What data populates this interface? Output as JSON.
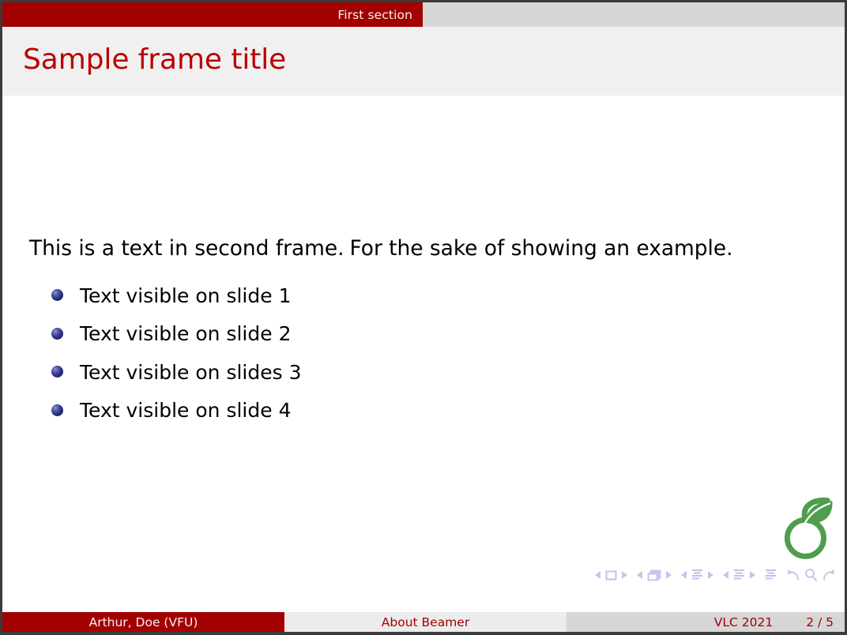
{
  "slide": {
    "section_bar": {
      "active_section": "First section"
    },
    "frame_title": "Sample frame title",
    "paragraph_part1": "This is a text in second frame.",
    "paragraph_part2": "For the sake of showing an example.",
    "bullets": [
      {
        "label": "Text visible on slide 1",
        "bullet_icon": "ball-bullet-icon"
      },
      {
        "label": "Text visible on slide 2",
        "bullet_icon": "ball-bullet-icon"
      },
      {
        "label": "Text visible on slides 3",
        "bullet_icon": "ball-bullet-icon"
      },
      {
        "label": "Text visible on slide 4",
        "bullet_icon": "ball-bullet-icon"
      }
    ],
    "logo": {
      "icon": "green-sprout-six-logo-icon"
    },
    "navigation_symbols": [
      "slide-previous-icon",
      "slide-icon",
      "slide-next-icon",
      "frame-previous-icon",
      "frame-icon",
      "frame-next-icon",
      "subsection-previous-icon",
      "subsection-icon",
      "subsection-next-icon",
      "section-previous-icon",
      "section-icon",
      "section-next-icon",
      "presentation-icon",
      "back-icon",
      "search-icon",
      "forward-icon"
    ],
    "footer": {
      "author": "Arthur, Doe  (VFU)",
      "title": "About Beamer",
      "date": "VLC 2021",
      "page": "2 / 5"
    }
  },
  "colors": {
    "beamer_red": "#a30000",
    "title_red": "#bb0000",
    "title_band": "#f0f0f0",
    "inactive_bar": "#d6d6d6",
    "footer_light": "#ececec",
    "bullet_navy": "#2d3184",
    "logo_green": "#4f9d4f",
    "nav_lavender": "#bfc2ea",
    "frame_border": "#3b3b3b"
  }
}
